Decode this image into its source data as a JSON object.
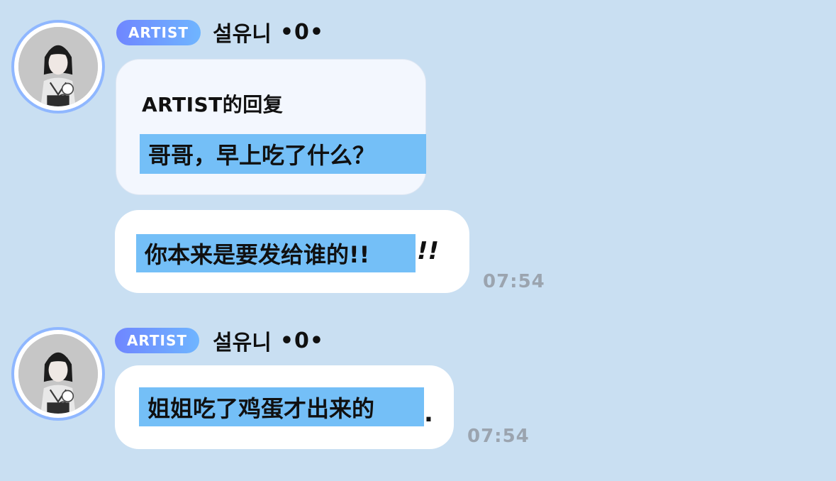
{
  "messages": [
    {
      "badge": "ARTIST",
      "username": "설유니",
      "status": "•0•",
      "reply": {
        "header": "ARTIST的回复",
        "text": "哥哥，早上吃了什么？"
      },
      "text": "你本来是要发给谁的!!",
      "overflow": "!!",
      "time": "07:54"
    },
    {
      "badge": "ARTIST",
      "username": "설유니",
      "status": "•0•",
      "text": "姐姐吃了鸡蛋才出来的",
      "overflow": ".",
      "time": "07:54"
    }
  ]
}
